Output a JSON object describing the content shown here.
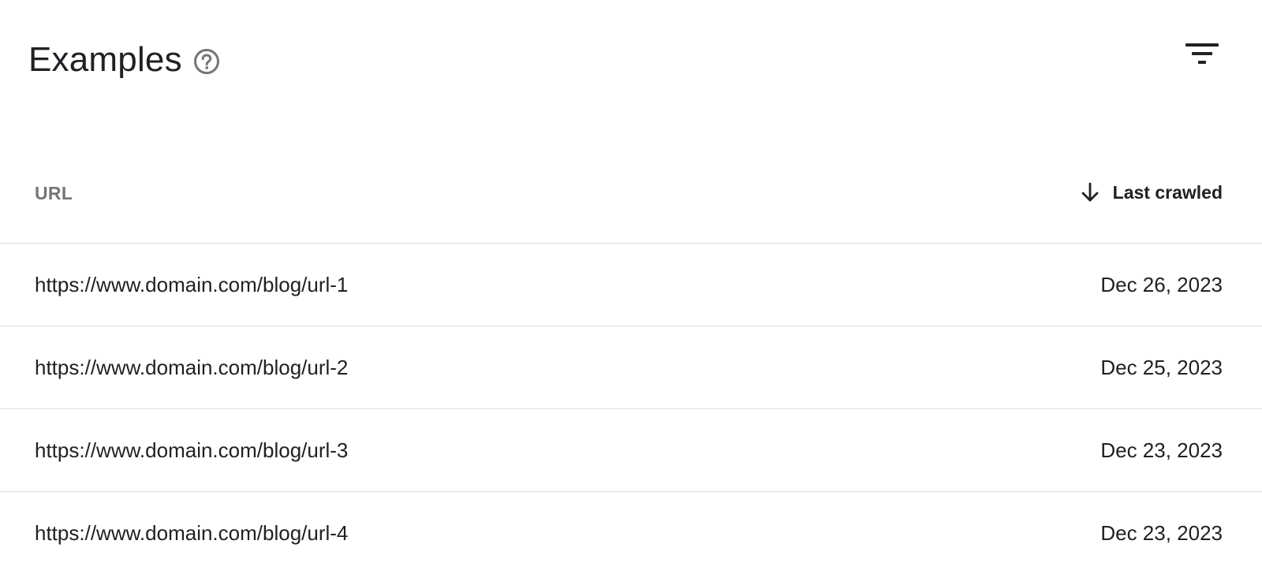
{
  "header": {
    "title": "Examples",
    "help_icon": "help-circle-icon",
    "filter_icon": "filter-icon"
  },
  "table": {
    "columns": {
      "url": "URL",
      "last_crawled": "Last crawled"
    },
    "sort_icon": "arrow-down-icon",
    "rows": [
      {
        "url": "https://www.domain.com/blog/url-1",
        "date": "Dec 26, 2023"
      },
      {
        "url": "https://www.domain.com/blog/url-2",
        "date": "Dec 25, 2023"
      },
      {
        "url": "https://www.domain.com/blog/url-3",
        "date": "Dec 23, 2023"
      },
      {
        "url": "https://www.domain.com/blog/url-4",
        "date": "Dec 23, 2023"
      }
    ]
  },
  "colors": {
    "text_primary": "#202124",
    "text_secondary": "#757575",
    "divider": "#dadce0",
    "icon": "#5f6368"
  }
}
